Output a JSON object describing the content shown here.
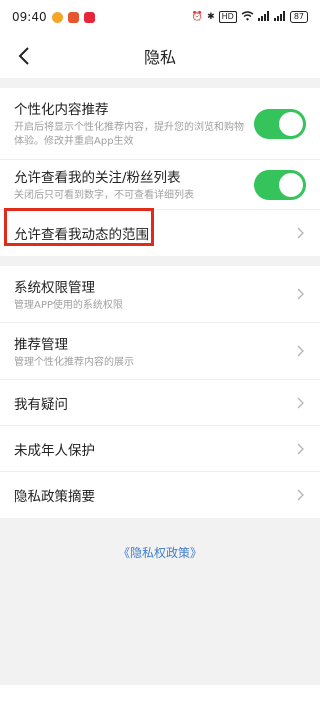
{
  "status_bar": {
    "time": "09:40",
    "hd_label": "HD",
    "battery": "87"
  },
  "nav": {
    "title": "隐私"
  },
  "settings": {
    "personalized": {
      "title": "个性化内容推荐",
      "desc": "开启后将显示个性化推荐内容，提升您的浏览和购物体验。修改并重启App生效",
      "enabled": true
    },
    "follow_list": {
      "title": "允许查看我的关注/粉丝列表",
      "desc": "关闭后只可看到数字，不可查看详细列表",
      "enabled": true
    },
    "moments_scope": {
      "title": "允许查看我动态的范围"
    },
    "system_permission": {
      "title": "系统权限管理",
      "desc": "管理APP使用的系统权限"
    },
    "recommend_manage": {
      "title": "推荐管理",
      "desc": "管理个性化推荐内容的展示"
    },
    "questions": {
      "title": "我有疑问"
    },
    "minor_protection": {
      "title": "未成年人保护"
    },
    "policy_summary": {
      "title": "隐私政策摘要"
    }
  },
  "footer": {
    "policy_link": "《隐私权政策》"
  },
  "colors": {
    "toggle_on": "#35c35c",
    "highlight": "#e02a1a",
    "link": "#3f7fcf"
  }
}
